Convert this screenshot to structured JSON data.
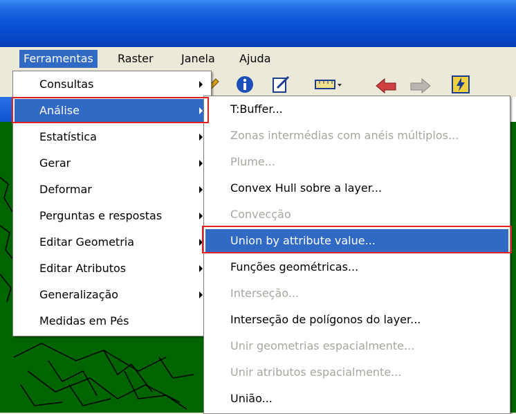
{
  "menubar": {
    "items": [
      "Ferramentas",
      "Raster",
      "Janela",
      "Ajuda"
    ],
    "active_index": 0
  },
  "ferramentas_menu": {
    "items": [
      {
        "label": "Consultas",
        "submenu": true
      },
      {
        "label": "Análise",
        "submenu": true,
        "highlighted": true
      },
      {
        "label": "Estatística",
        "submenu": true
      },
      {
        "label": "Gerar",
        "submenu": true
      },
      {
        "label": "Deformar",
        "submenu": true
      },
      {
        "label": "Perguntas e respostas",
        "submenu": true
      },
      {
        "label": "Editar Geometria",
        "submenu": true
      },
      {
        "label": "Editar Atributos",
        "submenu": true
      },
      {
        "label": "Generalização",
        "submenu": true
      },
      {
        "label": "Medidas em Pés",
        "submenu": false
      }
    ]
  },
  "analise_submenu": {
    "items": [
      {
        "label": "T:Buffer...",
        "enabled": true
      },
      {
        "label": "Zonas intermédias com anéis múltiplos...",
        "enabled": false
      },
      {
        "label": "Plume...",
        "enabled": false
      },
      {
        "label": "Convex Hull sobre a layer...",
        "enabled": true
      },
      {
        "label": "Convecção",
        "enabled": false
      },
      {
        "label": "Union by attribute value...",
        "enabled": true,
        "highlighted": true
      },
      {
        "label": "Funções geométricas...",
        "enabled": true
      },
      {
        "label": "Interseção...",
        "enabled": false
      },
      {
        "label": "Interseção de polígonos do layer...",
        "enabled": true
      },
      {
        "label": "Unir geometrias espacialmente...",
        "enabled": false
      },
      {
        "label": "Unir atributos espacialmente...",
        "enabled": false
      },
      {
        "label": "União...",
        "enabled": true
      }
    ]
  },
  "colors": {
    "highlight": "#316ac5",
    "annotation_box": "#e02020",
    "map_fill": "#006400"
  },
  "toolbar": {
    "icons": [
      "pencil-icon",
      "info-icon",
      "edit-icon",
      "ruler-icon",
      "back-arrow-icon",
      "forward-arrow-icon",
      "lightning-icon"
    ]
  }
}
